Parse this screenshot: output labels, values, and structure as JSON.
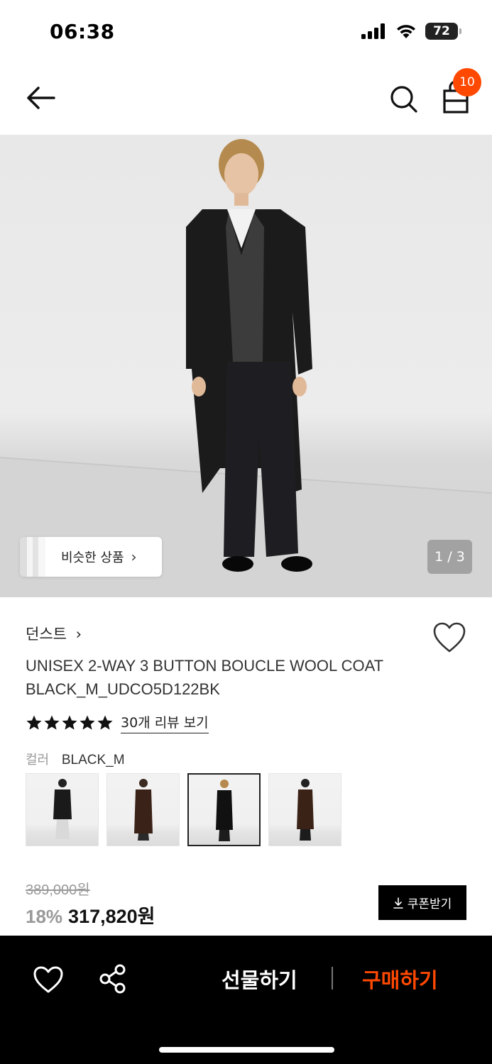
{
  "status": {
    "time": "06:38",
    "battery": "72"
  },
  "header": {
    "cart_count": "10"
  },
  "hero": {
    "similar_label": "비슷한 상품",
    "page_indicator": "1 / 3"
  },
  "product": {
    "brand": "던스트",
    "name_line1": "UNISEX 2-WAY 3 BUTTON BOUCLE WOOL COAT",
    "name_line2": "BLACK_M_UDCO5D122BK",
    "rating_stars": 5,
    "review_link": "30개 리뷰 보기",
    "color_label": "컬러",
    "color_value": "BLACK_M",
    "swatches": [
      {
        "coat": "#1a1a1a",
        "pants": "#d9d9d9"
      },
      {
        "coat": "#3a2218",
        "pants": "#2a2a2a"
      },
      {
        "coat": "#111111",
        "pants": "#1c1c1c"
      },
      {
        "coat": "#3b2216",
        "pants": "#1c1c1c"
      }
    ],
    "selected_swatch": 2
  },
  "price": {
    "original": "389,000원",
    "discount": "18%",
    "sale": "317,820원",
    "coupon_label": "쿠폰받기"
  },
  "bottom": {
    "gift_label": "선물하기",
    "buy_label": "구매하기"
  },
  "colors": {
    "accent": "#ff4800",
    "bar": "#000000"
  }
}
